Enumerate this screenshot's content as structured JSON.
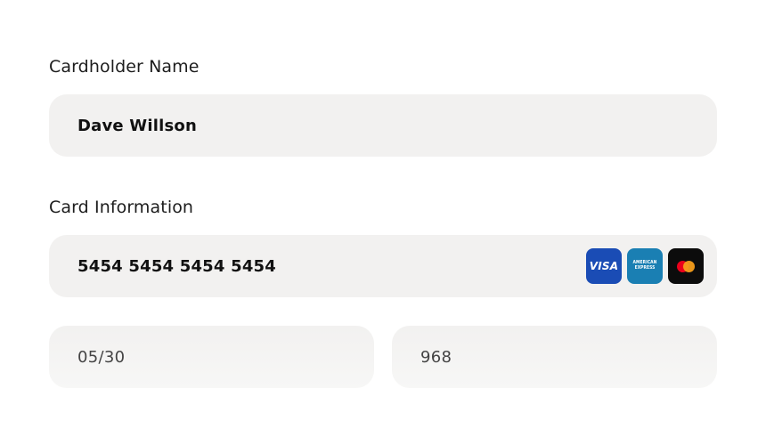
{
  "form": {
    "cardholder": {
      "label": "Cardholder Name",
      "value": "Dave Willson"
    },
    "card_info": {
      "label": "Card Information",
      "number": "5454 5454 5454 5454",
      "brands": [
        {
          "name": "visa",
          "text": "VISA",
          "color": "#1a4cb5"
        },
        {
          "name": "amex",
          "text": "AMERICAN EXPRESS",
          "color": "#1a7fb3"
        },
        {
          "name": "mastercard",
          "color": "#0c0c0c"
        }
      ],
      "expiry": "05/30",
      "cvc": "968"
    }
  }
}
